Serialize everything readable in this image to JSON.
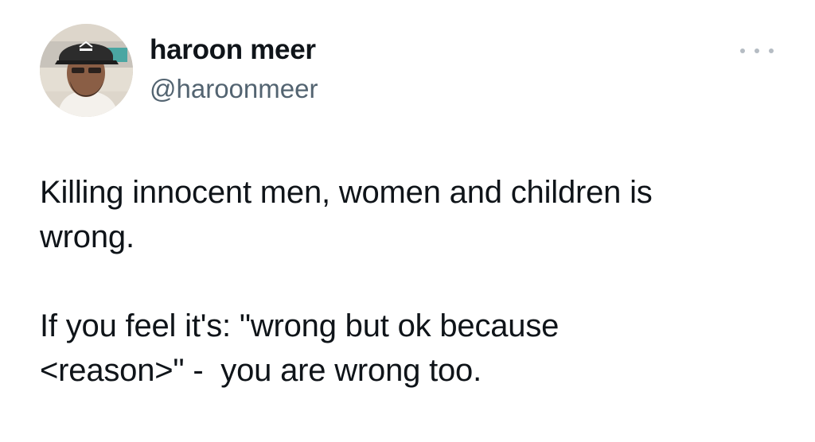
{
  "author": {
    "display_name": "haroon meer",
    "handle": "@haroonmeer",
    "avatar_icon": "profile-photo-man-in-cap"
  },
  "menu": {
    "icon": "more-horizontal-icon"
  },
  "tweet": {
    "paragraphs": [
      "Killing innocent men, women and children is\nwrong.",
      "If you feel it's: \"wrong but ok because\n<reason>\" -  you are wrong too."
    ]
  },
  "colors": {
    "text": "#0f1419",
    "secondary_text": "#536471",
    "menu_dots": "#b5bcc3",
    "background": "#ffffff"
  }
}
